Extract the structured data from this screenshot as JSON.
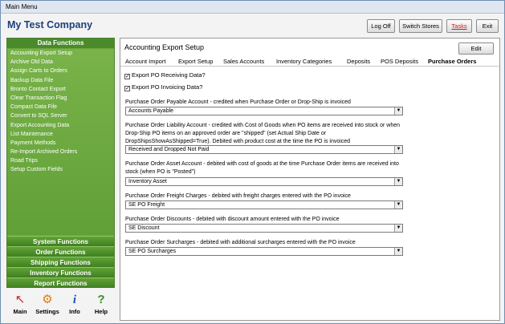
{
  "window": {
    "title": "Main Menu"
  },
  "header": {
    "company": "My Test Company",
    "buttons": {
      "logoff": "Log Off",
      "switch": "Switch Stores",
      "tasks": "Tasks",
      "exit": "Exit"
    }
  },
  "sidebar": {
    "heading": "Data Functions",
    "items": [
      "Accounting Export Setup",
      "Archive Old Data",
      "Assign Carts to Orders",
      "Backup Data File",
      "Bronto Contact Export",
      "Clear Transaction Flag",
      "Compact Data File",
      "Convert to SQL Server",
      "Export Accounting Data",
      "List Maintenance",
      "Payment Methods",
      "Re-Import Archived Orders",
      "Road Trips",
      "Setup Custom Fields"
    ],
    "groups": [
      "System Functions",
      "Order Functions",
      "Shipping Functions",
      "Inventory Functions",
      "Report Functions"
    ]
  },
  "bottom": {
    "main": "Main",
    "settings": "Settings",
    "info": "Info",
    "help": "Help"
  },
  "panel": {
    "title": "Accounting Export Setup",
    "edit": "Edit",
    "tabs": [
      "Account Import",
      "Export Setup",
      "Sales Accounts",
      "Inventory Categories",
      "Deposits",
      "POS Deposits",
      "Purchase Orders"
    ],
    "active_tab": "Purchase Orders",
    "checks": [
      {
        "label": "Export PO Receiving Data?",
        "checked": true
      },
      {
        "label": "Export PO Invoicing Data?",
        "checked": true
      }
    ],
    "fields": [
      {
        "label": "Purchase Order Payable  Account - credited when Purchase Order or Drop-Ship is invoiced",
        "value": "Accounts Payable"
      },
      {
        "label": "Purchase Order Liability Account - credited with Cost of Goods when PO items are received into stock or when Drop-Ship PO items on an approved order are \"shipped\" (set Actual Ship Date or DropShipsShowAsShipped=True). Debited with product cost at the time the PO is invoiced",
        "value": "Received and Dropped Not Paid"
      },
      {
        "label": "Purchase Order Asset Account - debited with cost of goods at the time Purchase Order items are received into stock (when PO is \"Posted\")",
        "value": "Inventory Asset"
      },
      {
        "label": "Purchase Order Freight Charges - debited with freight charges entered with the PO invoice",
        "value": "SE PO Freight"
      },
      {
        "label": "Purchase Order Discounts - debited with discount amount entered with the PO invoice",
        "value": "SE Discount"
      },
      {
        "label": "Purchase Order Surcharges - debited with additional surcharges entered with the PO invoice",
        "value": "SE PO Surcharges"
      }
    ]
  }
}
